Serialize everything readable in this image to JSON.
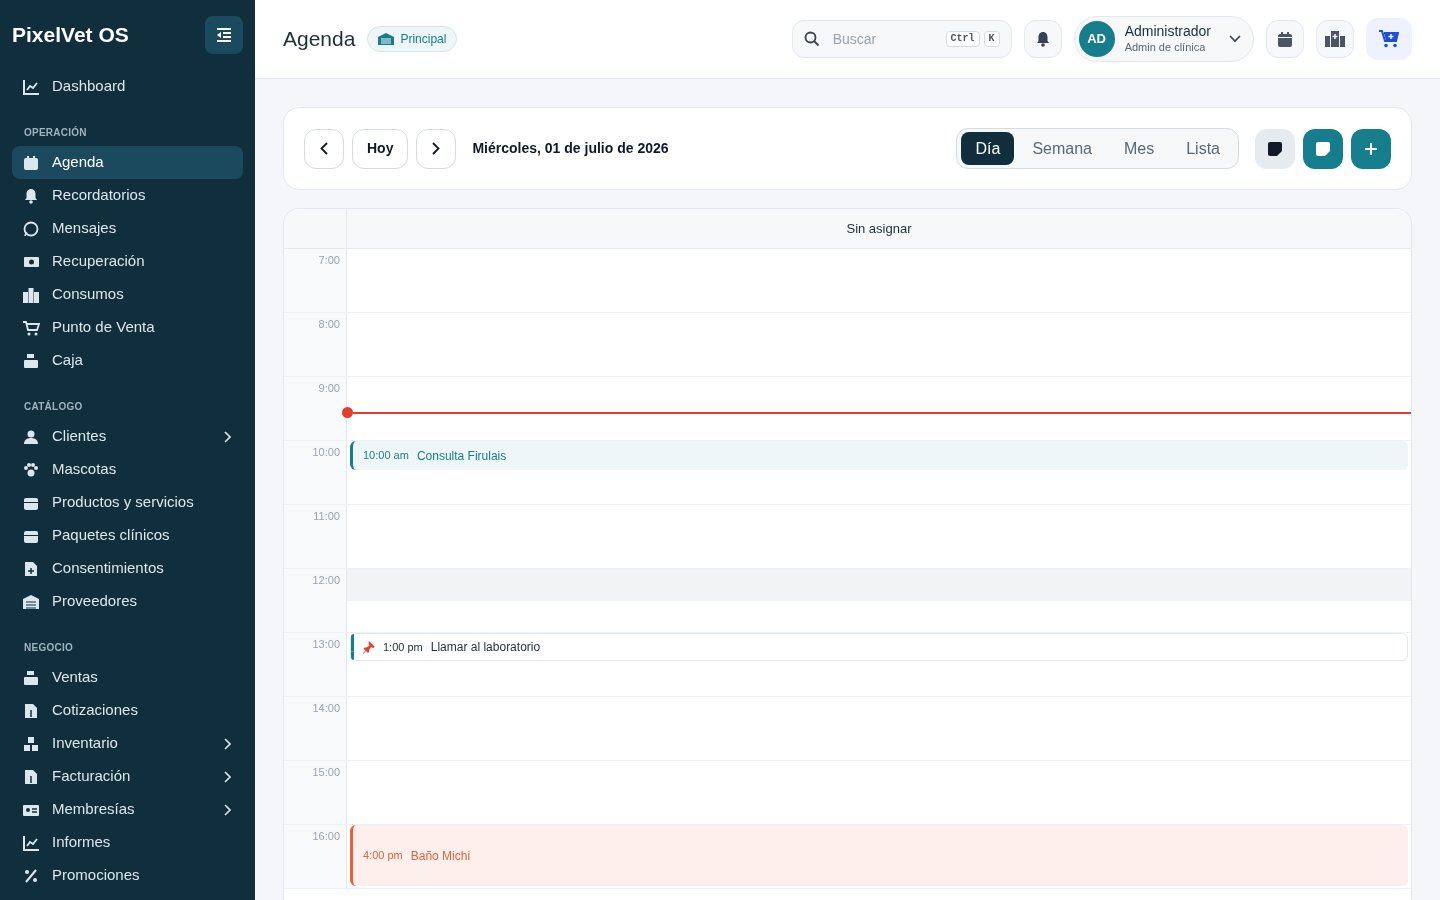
{
  "app": {
    "name": "PixelVet OS"
  },
  "sidebar": {
    "sections": [
      {
        "items": [
          {
            "label": "Dashboard",
            "selected": false,
            "expandable": false
          }
        ]
      },
      {
        "title": "OPERACIÓN",
        "items": [
          {
            "label": "Agenda",
            "selected": true,
            "expandable": false
          },
          {
            "label": "Recordatorios",
            "selected": false,
            "expandable": false
          },
          {
            "label": "Mensajes",
            "selected": false,
            "expandable": false
          },
          {
            "label": "Recuperación",
            "selected": false,
            "expandable": false
          },
          {
            "label": "Consumos",
            "selected": false,
            "expandable": false
          },
          {
            "label": "Punto de Venta",
            "selected": false,
            "expandable": false
          },
          {
            "label": "Caja",
            "selected": false,
            "expandable": false
          }
        ]
      },
      {
        "title": "CATÁLOGO",
        "items": [
          {
            "label": "Clientes",
            "selected": false,
            "expandable": true
          },
          {
            "label": "Mascotas",
            "selected": false,
            "expandable": false
          },
          {
            "label": "Productos y servicios",
            "selected": false,
            "expandable": false
          },
          {
            "label": "Paquetes clínicos",
            "selected": false,
            "expandable": false
          },
          {
            "label": "Consentimientos",
            "selected": false,
            "expandable": false
          },
          {
            "label": "Proveedores",
            "selected": false,
            "expandable": false
          }
        ]
      },
      {
        "title": "NEGOCIO",
        "items": [
          {
            "label": "Ventas",
            "selected": false,
            "expandable": false
          },
          {
            "label": "Cotizaciones",
            "selected": false,
            "expandable": false
          },
          {
            "label": "Inventario",
            "selected": false,
            "expandable": true
          },
          {
            "label": "Facturación",
            "selected": false,
            "expandable": true
          },
          {
            "label": "Membresías",
            "selected": false,
            "expandable": true
          },
          {
            "label": "Informes",
            "selected": false,
            "expandable": false
          },
          {
            "label": "Promociones",
            "selected": false,
            "expandable": false
          }
        ]
      }
    ]
  },
  "header": {
    "title": "Agenda",
    "badge": "Principal",
    "search": {
      "placeholder": "Buscar",
      "shortcut": [
        "Ctrl",
        "K"
      ]
    },
    "user": {
      "initials": "AD",
      "name": "Administrador",
      "role": "Admin de clínica"
    }
  },
  "toolbar": {
    "today": "Hoy",
    "date": "Miércoles, 01 de julio de 2026",
    "views": [
      {
        "label": "Día",
        "selected": true
      },
      {
        "label": "Semana",
        "selected": false
      },
      {
        "label": "Mes",
        "selected": false
      },
      {
        "label": "Lista",
        "selected": false
      }
    ]
  },
  "calendar": {
    "column": "Sin asignar",
    "hours": [
      {
        "label": "7:00"
      },
      {
        "label": "8:00"
      },
      {
        "label": "9:00",
        "now_line": true
      },
      {
        "label": "10:00",
        "events": [
          {
            "kind": "appointment",
            "time": "10:00 am",
            "title": "Consulta Firulais",
            "color": "#167d8c"
          }
        ]
      },
      {
        "label": "11:00"
      },
      {
        "label": "12:00",
        "blocked": true
      },
      {
        "label": "13:00",
        "events": [
          {
            "kind": "reminder",
            "time": "1:00 pm",
            "title": "Llamar al laboratorio",
            "color": "#167d8c"
          }
        ]
      },
      {
        "label": "14:00"
      },
      {
        "label": "15:00"
      },
      {
        "label": "16:00",
        "events": [
          {
            "kind": "service",
            "time": "4:00 pm",
            "title": "Baño Michi",
            "color": "#e8603c"
          }
        ]
      }
    ]
  }
}
